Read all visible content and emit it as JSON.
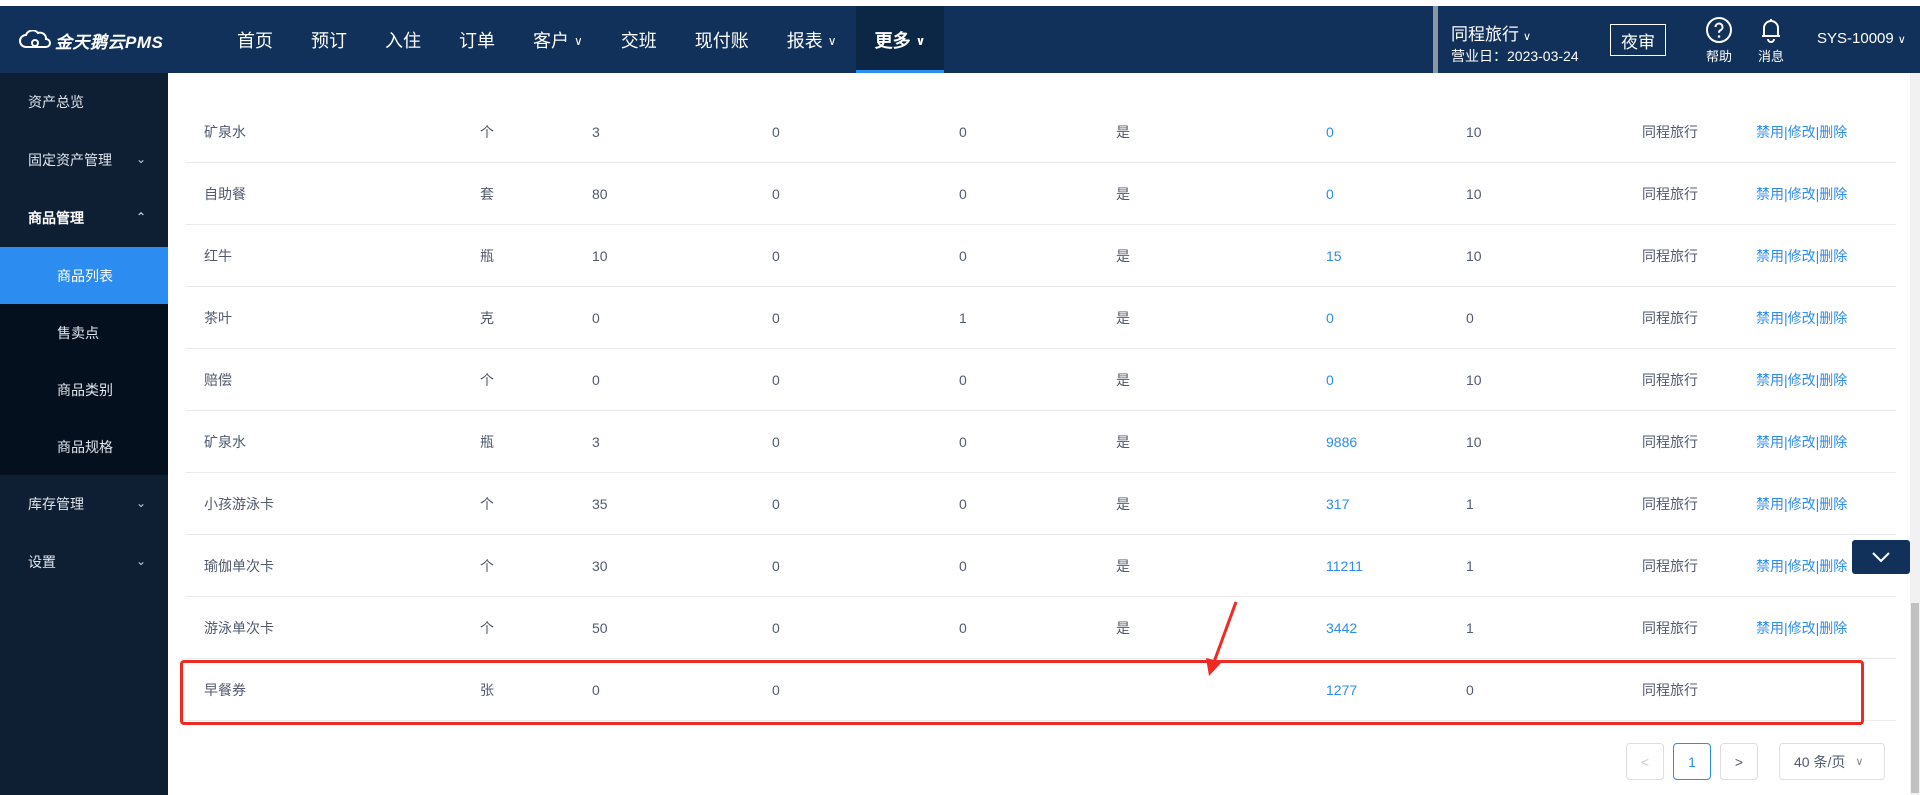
{
  "brand": {
    "name": "金天鹅云PMS"
  },
  "nav": {
    "items": [
      {
        "label": "首页",
        "chevron": false
      },
      {
        "label": "预订",
        "chevron": false
      },
      {
        "label": "入住",
        "chevron": false
      },
      {
        "label": "订单",
        "chevron": false
      },
      {
        "label": "客户",
        "chevron": true
      },
      {
        "label": "交班",
        "chevron": false
      },
      {
        "label": "现付账",
        "chevron": false
      },
      {
        "label": "报表",
        "chevron": true
      },
      {
        "label": "更多",
        "chevron": true,
        "active": true
      }
    ],
    "chevron_glyph": "∨"
  },
  "header": {
    "hotel_name": "同程旅行",
    "business_date": "营业日：2023-03-24",
    "night_audit": "夜审",
    "help": "帮助",
    "messages": "消息",
    "user": "SYS-10009"
  },
  "sidebar": {
    "items": [
      {
        "label": "资产总览"
      },
      {
        "label": "固定资产管理",
        "arrow": "⌄"
      },
      {
        "label": "商品管理",
        "arrow": "⌃",
        "open": true
      },
      {
        "label": "库存管理",
        "arrow": "⌄"
      },
      {
        "label": "设置",
        "arrow": "⌄"
      }
    ],
    "sub_items": [
      {
        "label": "商品列表",
        "current": true
      },
      {
        "label": "售卖点"
      },
      {
        "label": "商品类别"
      },
      {
        "label": "商品规格"
      }
    ]
  },
  "table": {
    "op_labels": [
      "禁用",
      "修改",
      "删除"
    ],
    "op_separator": "|",
    "rows": [
      {
        "name": "矿泉水",
        "unit": "个",
        "price": "3",
        "c4": "0",
        "c5": "0",
        "c6": "是",
        "stock": "0",
        "c8": "10",
        "hotel": "同程旅行",
        "ops": true
      },
      {
        "name": "自助餐",
        "unit": "套",
        "price": "80",
        "c4": "0",
        "c5": "0",
        "c6": "是",
        "stock": "0",
        "c8": "10",
        "hotel": "同程旅行",
        "ops": true
      },
      {
        "name": "红牛",
        "unit": "瓶",
        "price": "10",
        "c4": "0",
        "c5": "0",
        "c6": "是",
        "stock": "15",
        "c8": "10",
        "hotel": "同程旅行",
        "ops": true
      },
      {
        "name": "茶叶",
        "unit": "克",
        "price": "0",
        "c4": "0",
        "c5": "1",
        "c6": "是",
        "stock": "0",
        "c8": "0",
        "hotel": "同程旅行",
        "ops": true
      },
      {
        "name": "赔偿",
        "unit": "个",
        "price": "0",
        "c4": "0",
        "c5": "0",
        "c6": "是",
        "stock": "0",
        "c8": "10",
        "hotel": "同程旅行",
        "ops": true
      },
      {
        "name": "矿泉水",
        "unit": "瓶",
        "price": "3",
        "c4": "0",
        "c5": "0",
        "c6": "是",
        "stock": "9886",
        "c8": "10",
        "hotel": "同程旅行",
        "ops": true
      },
      {
        "name": "小孩游泳卡",
        "unit": "个",
        "price": "35",
        "c4": "0",
        "c5": "0",
        "c6": "是",
        "stock": "317",
        "c8": "1",
        "hotel": "同程旅行",
        "ops": true
      },
      {
        "name": "瑜伽单次卡",
        "unit": "个",
        "price": "30",
        "c4": "0",
        "c5": "0",
        "c6": "是",
        "stock": "11211",
        "c8": "1",
        "hotel": "同程旅行",
        "ops": true
      },
      {
        "name": "游泳单次卡",
        "unit": "个",
        "price": "50",
        "c4": "0",
        "c5": "0",
        "c6": "是",
        "stock": "3442",
        "c8": "1",
        "hotel": "同程旅行",
        "ops": true
      },
      {
        "name": "早餐券",
        "unit": "张",
        "price": "0",
        "c4": "0",
        "c5": "",
        "c6": "",
        "stock": "1277",
        "c8": "0",
        "hotel": "同程旅行",
        "ops": false
      }
    ]
  },
  "pagination": {
    "prev": "<",
    "current": "1",
    "next": ">",
    "page_size": "40 条/页"
  },
  "colors": {
    "topbar": "#11315a",
    "sidebar": "#0e1e33",
    "accent": "#2d8cf0",
    "highlight": "#ee2a22"
  },
  "icons": [
    "cloud-logo-icon",
    "help-circle-icon",
    "bell-icon",
    "chevron-down-icon",
    "annotation-arrow-icon"
  ]
}
